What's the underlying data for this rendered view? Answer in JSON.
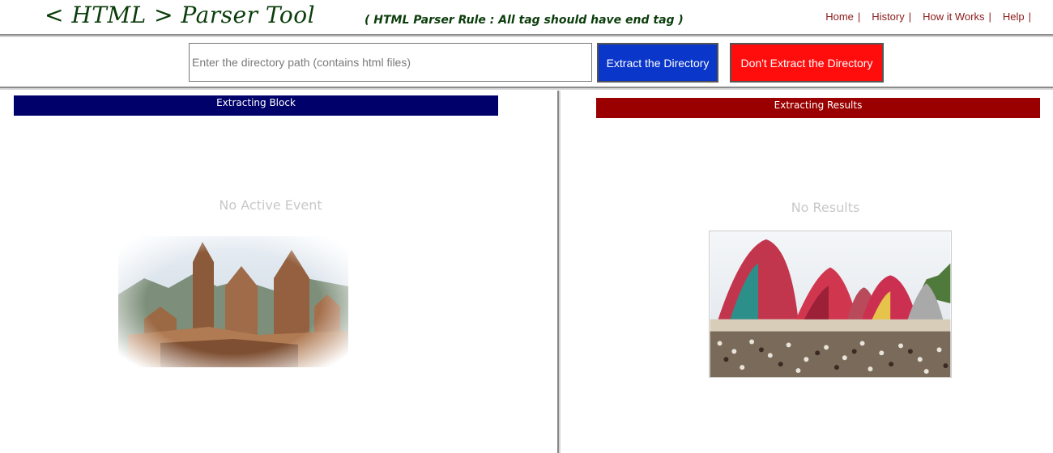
{
  "header": {
    "title": "< HTML > Parser Tool",
    "rule": "( HTML Parser Rule : All tag should have end tag )",
    "nav": [
      {
        "label": "Home",
        "sep": "|"
      },
      {
        "label": "History",
        "sep": "|"
      },
      {
        "label": "How it Works",
        "sep": "|"
      },
      {
        "label": "Help",
        "sep": "|"
      }
    ]
  },
  "toolbar": {
    "path_placeholder": "Enter the directory path (contains html files)",
    "path_value": "",
    "extract_label": "Extract the Directory",
    "no_extract_label": "Don't Extract the Directory",
    "extract_color": "#0a36c9",
    "no_extract_color": "#ff0d0d"
  },
  "left_panel": {
    "header": "Extracting Block",
    "header_color": "#00006b",
    "empty_text": "No Active Event",
    "image": "temple-collage-photo"
  },
  "right_panel": {
    "header": "Extracting Results",
    "header_color": "#9a0000",
    "empty_text": "No Results",
    "image": "rath-yatra-chariots-photo"
  }
}
